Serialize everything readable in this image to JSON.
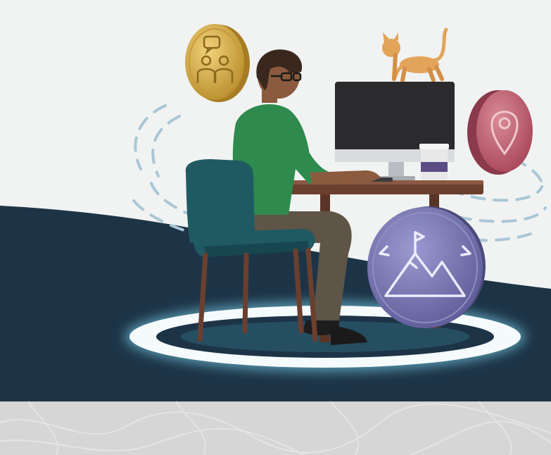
{
  "scene": {
    "description_icons": [
      "chat-people-icon",
      "map-pin-icon",
      "mountain-flag-icon"
    ],
    "colors": {
      "sky": "#f1f2f2",
      "ground": "#1d3447",
      "band": "#d9d9d9",
      "gold_coin": "#d8b24a",
      "pink_coin": "#c76473",
      "purple_coin": "#7b79b3",
      "shirt": "#2f8a4d",
      "chair": "#1f5a63",
      "cat": "#e2a45a",
      "glow": "#7ed6f0"
    }
  }
}
